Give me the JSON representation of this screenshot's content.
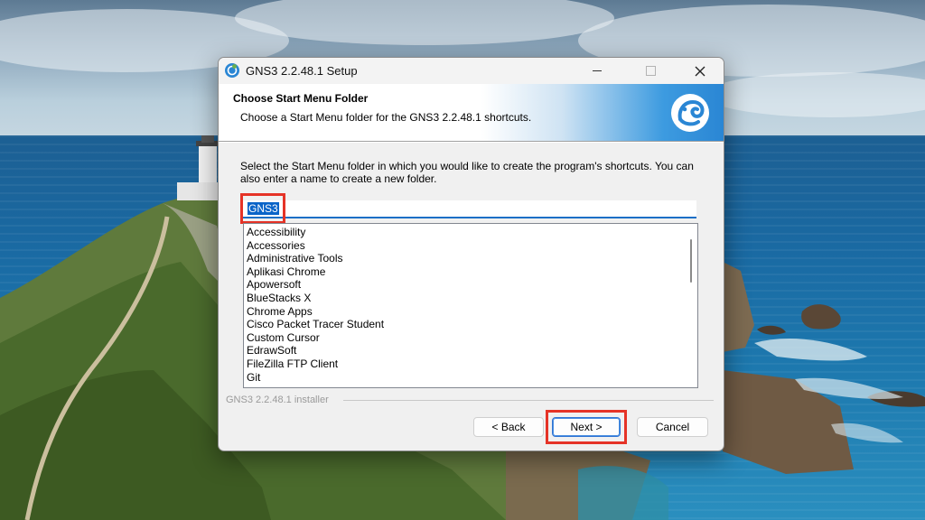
{
  "window": {
    "title": "GNS3 2.2.48.1 Setup",
    "controls": {
      "minimize": "minimize",
      "maximize": "maximize",
      "close": "close"
    }
  },
  "header": {
    "title": "Choose Start Menu Folder",
    "subtitle": "Choose a Start Menu folder for the GNS3 2.2.48.1 shortcuts.",
    "logo_icon": "gns3-chameleon-icon"
  },
  "description": "Select the Start Menu folder in which you would like to create the program's shortcuts. You can also enter a name to create a new folder.",
  "folder_input": {
    "value": "GNS3"
  },
  "folder_list": {
    "items": [
      "Accessibility",
      "Accessories",
      "Administrative Tools",
      "Aplikasi Chrome",
      "Apowersoft",
      "BlueStacks X",
      "Chrome Apps",
      "Cisco Packet Tracer Student",
      "Custom Cursor",
      "EdrawSoft",
      "FileZilla FTP Client",
      "Git"
    ]
  },
  "footer": {
    "label": "GNS3 2.2.48.1 installer"
  },
  "buttons": {
    "back": "< Back",
    "next": "Next >",
    "cancel": "Cancel"
  },
  "colors": {
    "highlight_red": "#e53327",
    "selection_blue": "#0a64c8",
    "header_accent": "#2a86d4"
  }
}
